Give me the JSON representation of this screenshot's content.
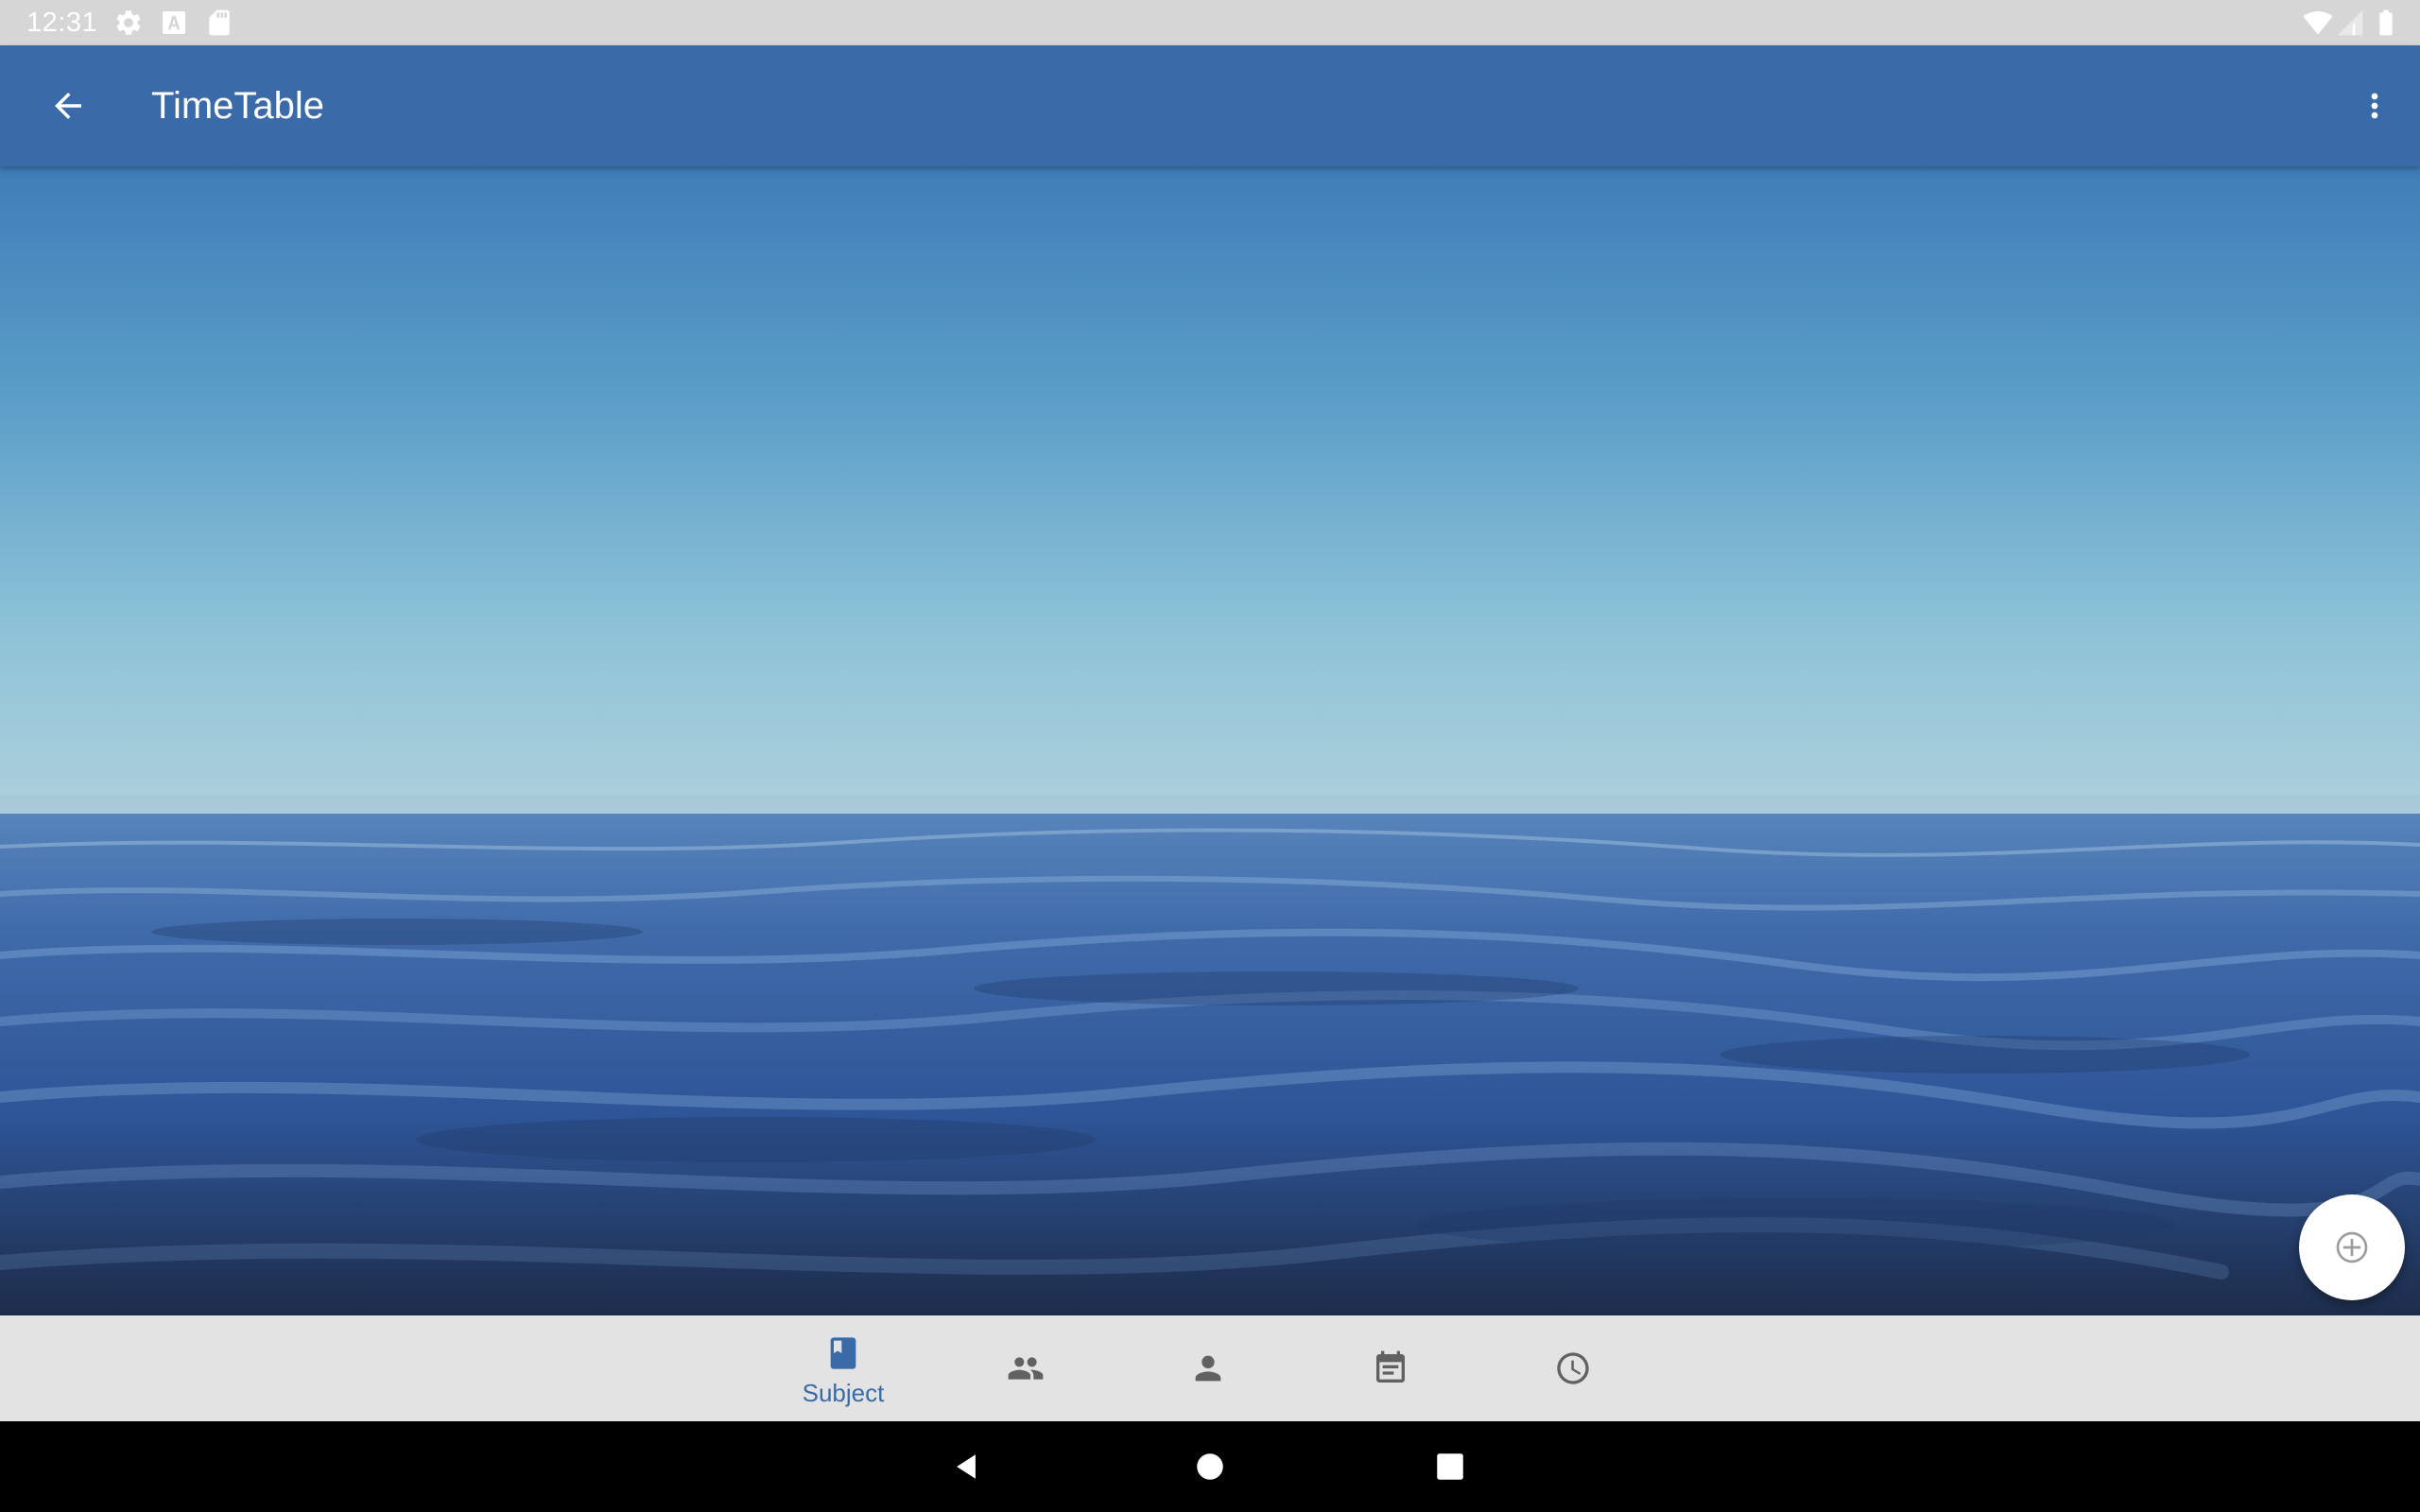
{
  "status_bar": {
    "time": "12:31",
    "left_icons": [
      "settings-icon",
      "font-a-icon",
      "sd-card-icon"
    ],
    "right_icons": [
      "wifi-icon",
      "cell-signal-icon",
      "battery-icon"
    ]
  },
  "app_bar": {
    "title": "TimeTable",
    "back_icon": "arrow-back-icon",
    "overflow_icon": "more-vert-icon",
    "color": "#3a6aa8"
  },
  "background": {
    "description_icon": "ocean-horizon-image"
  },
  "fab": {
    "icon": "add-circle-icon"
  },
  "bottom_nav": {
    "items": [
      {
        "label": "Subject",
        "icon": "book-icon",
        "selected": true
      },
      {
        "label": "",
        "icon": "group-icon",
        "selected": false
      },
      {
        "label": "",
        "icon": "person-icon",
        "selected": false
      },
      {
        "label": "",
        "icon": "event-note-icon",
        "selected": false
      },
      {
        "label": "",
        "icon": "clock-icon",
        "selected": false
      }
    ],
    "active_color": "#3a6aa8",
    "inactive_color": "#616161"
  },
  "system_nav": {
    "buttons": [
      "back-triangle-icon",
      "home-circle-icon",
      "recents-square-icon"
    ]
  }
}
